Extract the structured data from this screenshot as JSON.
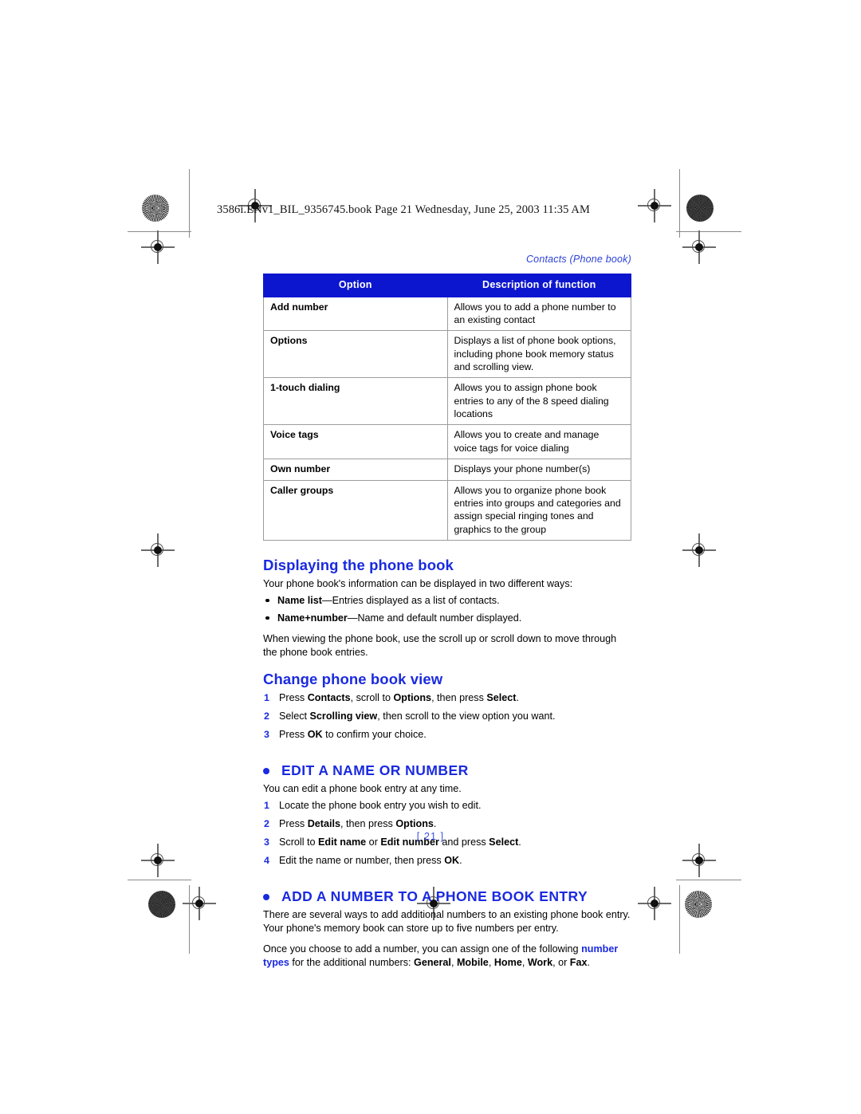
{
  "file_header": "3586i.ENv1_BIL_9356745.book  Page 21  Wednesday, June 25, 2003  11:35 AM",
  "running_head": "Contacts (Phone book)",
  "folio": "[ 21 ]",
  "colors": {
    "brand_blue": "#1a2ae0",
    "table_header_blue": "#0d16cf",
    "table_border_gray": "#9c9c9c",
    "body_black": "#000000"
  },
  "table": {
    "headers": [
      "Option",
      "Description of function"
    ],
    "rows": [
      {
        "option": "Add number",
        "description": "Allows you to add a phone number to an existing contact"
      },
      {
        "option": "Options",
        "description": "Displays a list of phone book options, including phone book memory status and scrolling view."
      },
      {
        "option": "1-touch dialing",
        "description": "Allows you to assign phone book entries to any of the 8 speed dialing locations"
      },
      {
        "option": "Voice tags",
        "description": "Allows you to create and manage voice tags for voice dialing"
      },
      {
        "option": "Own number",
        "description": "Displays your phone number(s)"
      },
      {
        "option": "Caller groups",
        "description": "Allows you to organize phone book entries into groups and categories and assign special ringing tones and graphics to the group"
      }
    ]
  },
  "sections": {
    "displaying": {
      "heading": "Displaying the phone book",
      "intro": "Your phone book's information can be displayed in two different ways:",
      "bullets": [
        {
          "term": "Name list",
          "rest": "—Entries displayed as a list of contacts."
        },
        {
          "term": "Name+number",
          "rest": "—Name and default number displayed."
        }
      ],
      "outro": "When viewing the phone book, use the scroll up or scroll down to move through the phone book entries."
    },
    "change_view": {
      "heading": "Change phone book view",
      "steps": [
        {
          "num": "1",
          "text_parts": [
            "Press ",
            "Contacts",
            ", scroll to ",
            "Options",
            ", then press ",
            "Select",
            "."
          ]
        },
        {
          "num": "2",
          "text_parts": [
            "Select ",
            "Scrolling view",
            ", then scroll to the view option you want."
          ]
        },
        {
          "num": "3",
          "text_parts": [
            "Press ",
            "OK",
            " to confirm your choice."
          ]
        }
      ]
    },
    "edit_name": {
      "heading": "EDIT A NAME OR NUMBER",
      "intro": "You can edit a phone book entry at any time.",
      "steps": [
        {
          "num": "1",
          "text_parts": [
            "Locate the phone book entry you wish to edit."
          ]
        },
        {
          "num": "2",
          "text_parts": [
            "Press ",
            "Details",
            ", then press ",
            "Options",
            "."
          ]
        },
        {
          "num": "3",
          "text_parts": [
            "Scroll to ",
            "Edit name",
            " or ",
            "Edit number",
            " and press ",
            "Select",
            "."
          ]
        },
        {
          "num": "4",
          "text_parts": [
            "Edit the name or number, then press ",
            "OK",
            "."
          ]
        }
      ]
    },
    "add_number": {
      "heading": "ADD A NUMBER TO A PHONE BOOK ENTRY",
      "para1": "There are several ways to add additional numbers to an existing phone book entry. Your phone's memory book can store up to five numbers per entry.",
      "para2_pre": "Once you choose to add a number, you can assign one of the following ",
      "para2_term": "number types",
      "para2_mid": " for the additional numbers: ",
      "para2_types": [
        "General",
        "Mobile",
        "Home",
        "Work",
        "Fax"
      ],
      "para2_post": "."
    }
  }
}
